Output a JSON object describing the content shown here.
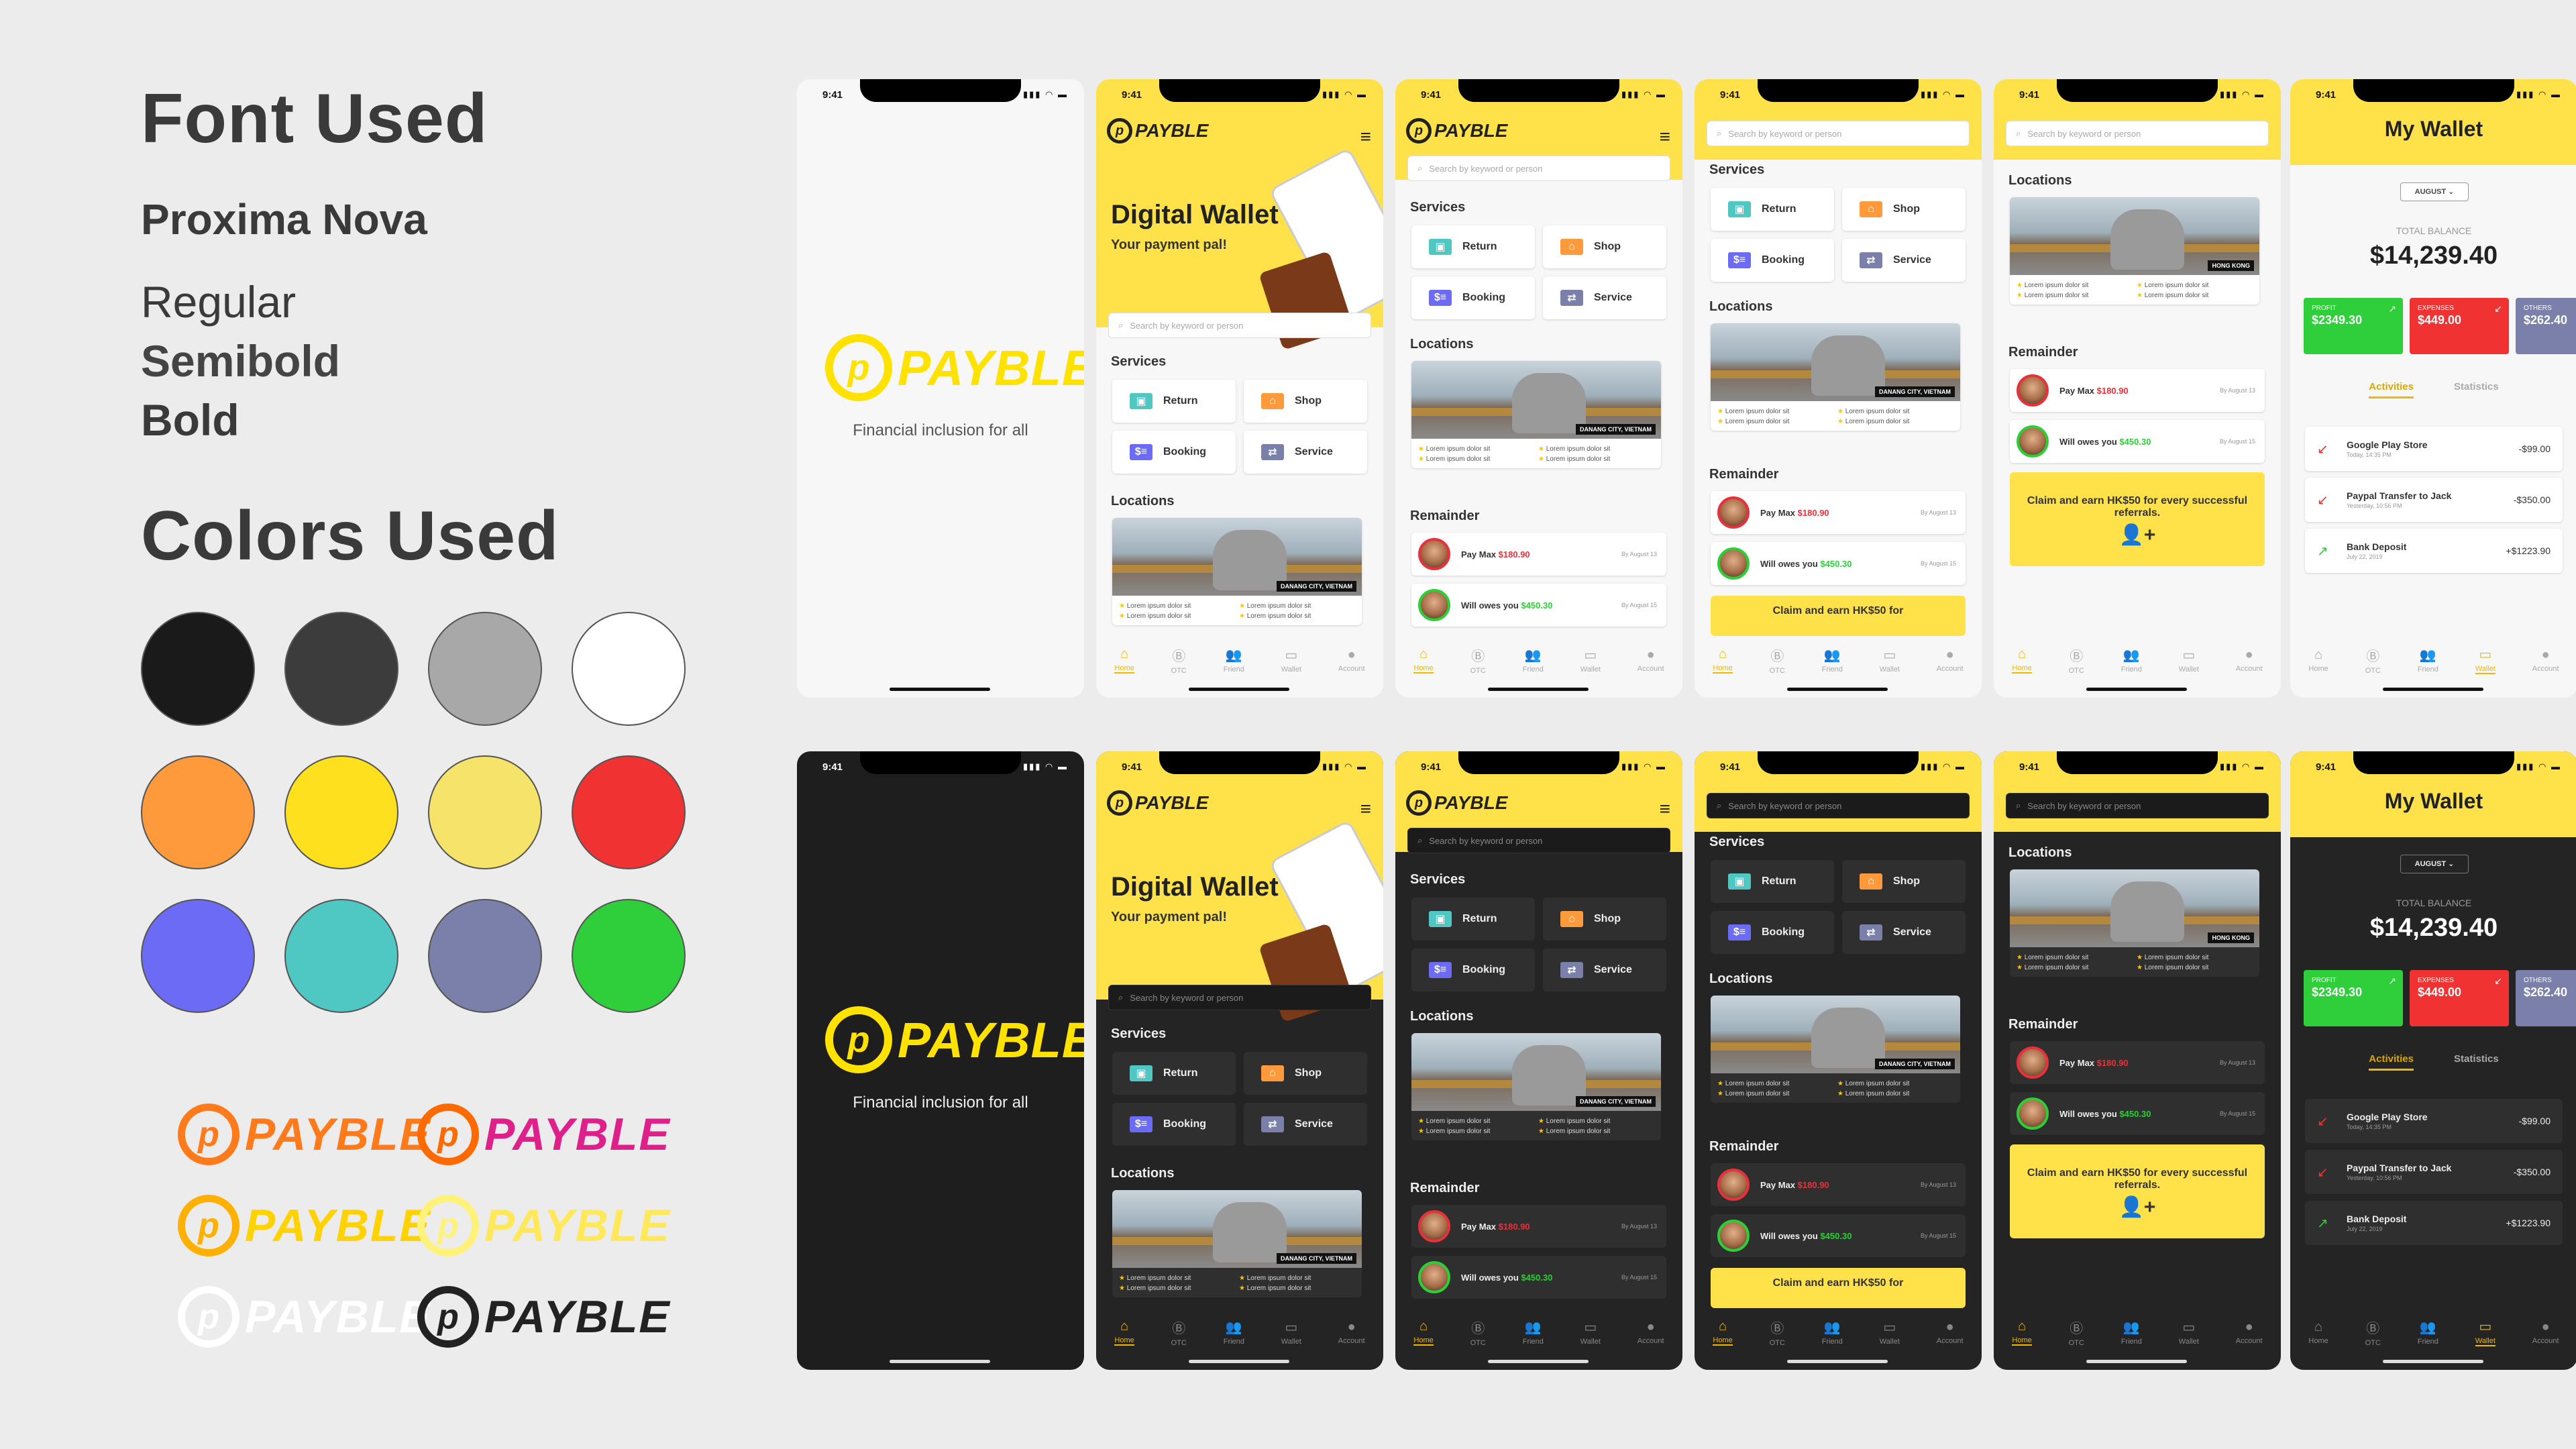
{
  "guide": {
    "font_heading": "Font Used",
    "font_name": "Proxima Nova",
    "weights": [
      "Regular",
      "Semibold",
      "Bold"
    ],
    "colors_heading": "Colors Used",
    "colors": [
      "#1a1a1a",
      "#3c3c3c",
      "#a8a8a8",
      "#ffffff",
      "#ff9a3c",
      "#ffe01e",
      "#f5e36a",
      "#f03232",
      "#6b6bf5",
      "#4fc8c4",
      "#7a80aa",
      "#2ecf3a"
    ],
    "logo_word": "PAYBLE",
    "logo_variants": [
      {
        "mark": "#ff7a1a",
        "word": "#ff7a1a"
      },
      {
        "mark": "#ff6a00",
        "word": "#e0208a"
      },
      {
        "mark": "#ffb000",
        "word": "#ffd200"
      },
      {
        "mark": "#fff27a",
        "word": "#ffe95a"
      },
      {
        "mark": "#ffffff",
        "word": "#ffffff"
      },
      {
        "mark": "#222222",
        "word": "#222222"
      }
    ]
  },
  "status": {
    "time": "9:41",
    "icons": "▮▮▮ ◠ ▬"
  },
  "app": {
    "logo_word": "PAYBLE",
    "tagline": "Financial inclusion for all",
    "hero_title": "Digital Wallet",
    "hero_sub": "Your payment pal!",
    "search_placeholder": "Search by keyword or person",
    "services_title": "Services",
    "services": [
      {
        "label": "Return",
        "icon": "cash-icon",
        "color": "#4fc8c4",
        "glyph": "▣"
      },
      {
        "label": "Shop",
        "icon": "shop-icon",
        "color": "#ff9a3c",
        "glyph": "⌂"
      },
      {
        "label": "Booking",
        "icon": "booking-icon",
        "color": "#6b6bf5",
        "glyph": "$≡"
      },
      {
        "label": "Service",
        "icon": "transfer-icon",
        "color": "#7a80aa",
        "glyph": "⇄"
      }
    ],
    "locations_title": "Locations",
    "location_tag": "DANANG CITY, VIETNAM",
    "location_tag_hk": "HONG KONG",
    "location_meta": [
      "Lorem ipsum dolor sit",
      "Lorem ipsum dolor sit",
      "Lorem ipsum dolor sit",
      "Lorem ipsum dolor sit"
    ],
    "remainder_title": "Remainder",
    "reminders": [
      {
        "prefix": "Pay Max ",
        "amount": "$180.90",
        "date": "By August 13",
        "ring": "#e8313a"
      },
      {
        "prefix": "Will owes you ",
        "amount": "$450.30",
        "date": "By August 15",
        "ring": "#2ccf36"
      }
    ],
    "promo": "Claim and earn HK$50 for every successful referrals.",
    "promo_cut": "Claim and earn HK$50 for",
    "tabs": [
      "Home",
      "OTC",
      "Friend",
      "Wallet",
      "Account"
    ]
  },
  "wallet": {
    "title": "My Wallet",
    "month": "AUGUST ⌄",
    "total_label": "TOTAL BALANCE",
    "total": "$14,239.40",
    "cards": [
      {
        "label": "PROFIT",
        "value": "$2349.30",
        "color": "#2ecf3a",
        "arrow": "↗"
      },
      {
        "label": "EXPENSES",
        "value": "$449.00",
        "color": "#f03232",
        "arrow": "↙"
      },
      {
        "label": "OTHERS",
        "value": "$262.40",
        "color": "#7a80aa",
        "arrow": ""
      }
    ],
    "tab_on": "Activities",
    "tab_off": "Statistics",
    "activities": [
      {
        "name": "Google Play Store",
        "date": "Today, 14:35 PM",
        "amount": "-$99.00",
        "arrow": "↙",
        "color": "#f03232"
      },
      {
        "name": "Paypal Transfer to Jack",
        "date": "Yesterday, 10:56 PM",
        "amount": "-$350.00",
        "arrow": "↙",
        "color": "#f03232"
      },
      {
        "name": "Bank Deposit",
        "date": "July 22, 2019",
        "amount": "+$1223.90",
        "arrow": "↗",
        "color": "#2ecf3a"
      }
    ]
  }
}
